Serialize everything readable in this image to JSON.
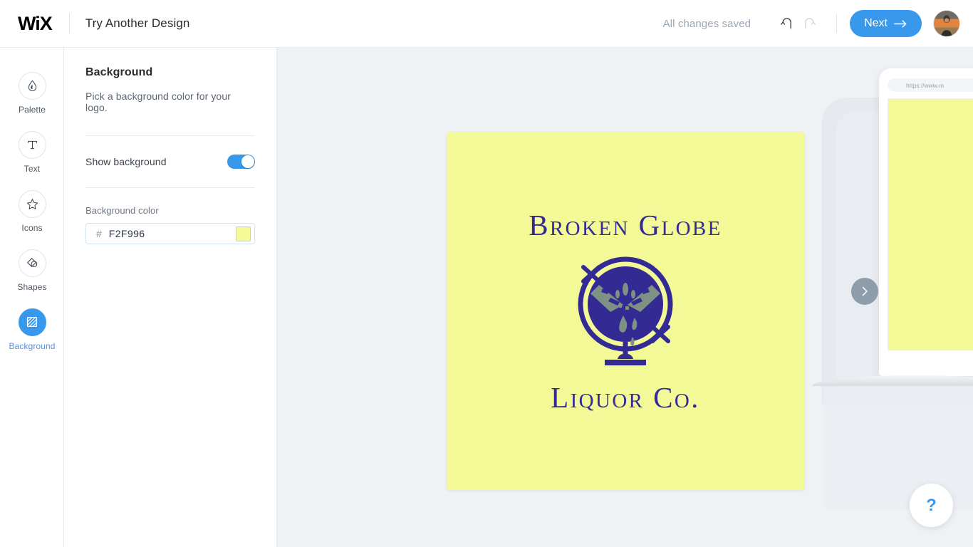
{
  "header": {
    "brand": "WiX",
    "title": "Try Another Design",
    "save_status": "All changes saved",
    "undo_icon": "undo-arrow-icon",
    "redo_icon": "redo-arrow-icon",
    "next_label": "Next",
    "next_arrow": "arrow-right-icon",
    "avatar_alt": "user-avatar"
  },
  "sidebar": {
    "items": [
      {
        "label": "Palette",
        "icon": "droplet-icon",
        "active": false
      },
      {
        "label": "Text",
        "icon": "text-t-icon",
        "active": false
      },
      {
        "label": "Icons",
        "icon": "star-icon",
        "active": false
      },
      {
        "label": "Shapes",
        "icon": "shapes-icon",
        "active": false
      },
      {
        "label": "Background",
        "icon": "background-hatch-icon",
        "active": true
      }
    ]
  },
  "panel": {
    "title": "Background",
    "subtitle": "Pick a background color for your logo.",
    "show_background_label": "Show background",
    "show_background_on": true,
    "background_color_label": "Background color",
    "hash_symbol": "#",
    "hex_value": "F2F996",
    "hex_placeholder": "F2F996"
  },
  "stage": {
    "canvas_bg": "#F2F996",
    "logo": {
      "top_text": "Broken Globe",
      "bottom_text": "Liquor Co.",
      "mark_icon": "globe-on-stand-icon",
      "ink_color": "#342a94",
      "continent_color": "#7d9184"
    },
    "preview": {
      "url_text": "https://www.m",
      "device_icon": "tablet-device-icon"
    },
    "carousel_next_icon": "chevron-right-icon",
    "help_label": "?"
  },
  "colors": {
    "accent": "#3899ec",
    "stage_bg": "#eff2f5",
    "logo_bg": "#F2F996",
    "logo_ink": "#342a94"
  }
}
